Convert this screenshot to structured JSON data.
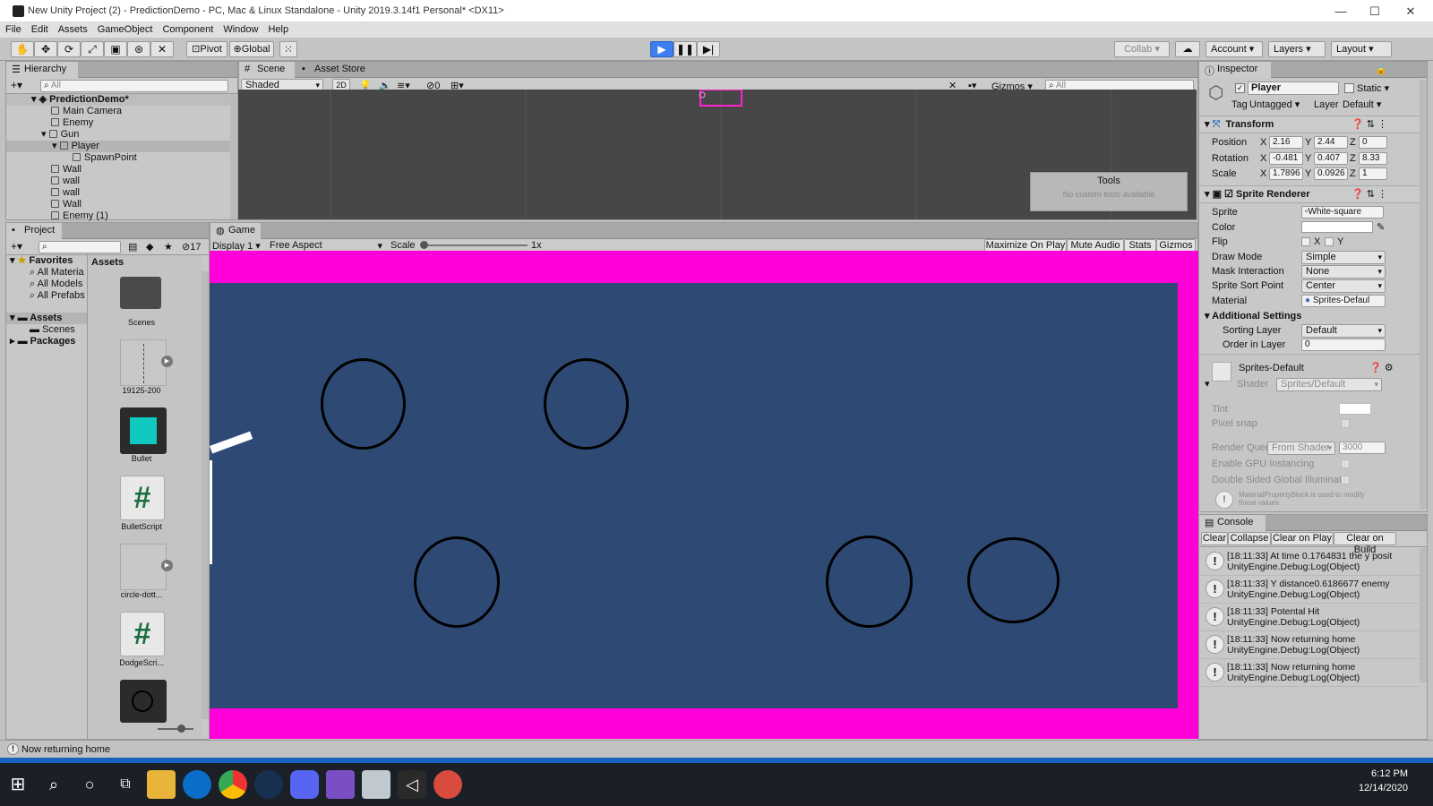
{
  "window": {
    "title": "New Unity Project (2) - PredictionDemo - PC, Mac & Linux Standalone - Unity 2019.3.14f1 Personal* <DX11>",
    "minimize": "—",
    "maximize": "☐",
    "close": "✕"
  },
  "menu": [
    "File",
    "Edit",
    "Assets",
    "GameObject",
    "Component",
    "Window",
    "Help"
  ],
  "toolbar": {
    "pivot": "Pivot",
    "global": "Global",
    "collab": "Collab",
    "account": "Account",
    "layers": "Layers",
    "layout": "Layout"
  },
  "hierarchy": {
    "tab": "Hierarchy",
    "search_placeholder": "All",
    "scene_name": "PredictionDemo*",
    "items": [
      {
        "name": "Main Camera",
        "indent": 1
      },
      {
        "name": "Enemy",
        "indent": 1
      },
      {
        "name": "Gun",
        "indent": 1
      },
      {
        "name": "Player",
        "indent": 2
      },
      {
        "name": "SpawnPoint",
        "indent": 3
      },
      {
        "name": "Wall",
        "indent": 1
      },
      {
        "name": "wall",
        "indent": 1
      },
      {
        "name": "wall",
        "indent": 1
      },
      {
        "name": "Wall",
        "indent": 1
      },
      {
        "name": "Enemy (1)",
        "indent": 1
      }
    ]
  },
  "scene": {
    "tab": "Scene",
    "asset_store_tab": "Asset Store",
    "shading": "Shaded",
    "mode2d": "2D",
    "fx_count": "0",
    "gizmos": "Gizmos",
    "search_placeholder": "All",
    "tools_title": "Tools",
    "tools_subtitle": "No custom tools available"
  },
  "project": {
    "tab": "Project",
    "count": "17",
    "favorites": "Favorites",
    "fav_items": [
      "All Materia",
      "All Models",
      "All Prefabs"
    ],
    "assets": "Assets",
    "asset_children": [
      "Scenes"
    ],
    "packages": "Packages",
    "grid_header": "Assets",
    "grid": [
      "Scenes",
      "19125-200",
      "Bullet",
      "BulletScript",
      "circle-dott...",
      "DodgeScri..."
    ]
  },
  "game": {
    "tab": "Game",
    "display": "Display 1",
    "aspect": "Free Aspect",
    "scale_label": "Scale",
    "scale_value": "1x",
    "maximize": "Maximize On Play",
    "mute": "Mute Audio",
    "stats": "Stats",
    "gizmos": "Gizmos"
  },
  "inspector": {
    "tab": "Inspector",
    "object_name": "Player",
    "static": "Static",
    "tag_label": "Tag",
    "tag": "Untagged",
    "layer_label": "Layer",
    "layer": "Default",
    "transform": {
      "title": "Transform",
      "position": {
        "label": "Position",
        "x": "2.16",
        "y": "2.44",
        "z": "0"
      },
      "rotation": {
        "label": "Rotation",
        "x": "-0.481",
        "y": "0.407",
        "z": "8.33"
      },
      "scale": {
        "label": "Scale",
        "x": "1.7896",
        "y": "0.0926",
        "z": "1"
      }
    },
    "sprite_renderer": {
      "title": "Sprite Renderer",
      "sprite_label": "Sprite",
      "sprite": "White-square",
      "color_label": "Color",
      "flip_label": "Flip",
      "flip_x": "X",
      "flip_y": "Y",
      "draw_mode_label": "Draw Mode",
      "draw_mode": "Simple",
      "mask_label": "Mask Interaction",
      "mask": "None",
      "sort_point_label": "Sprite Sort Point",
      "sort_point": "Center",
      "material_label": "Material",
      "material": "Sprites-Defaul",
      "additional": "Additional Settings",
      "sorting_layer_label": "Sorting Layer",
      "sorting_layer": "Default",
      "order_label": "Order in Layer",
      "order": "0"
    },
    "material": {
      "name": "Sprites-Default",
      "shader_label": "Shader",
      "shader": "Sprites/Default",
      "tint": "Tint",
      "pixel_snap": "Pixel snap",
      "render_queue": "Render Queu",
      "render_from": "From Shader",
      "render_value": "3000",
      "gpu": "Enable GPU Instancing",
      "double_sided": "Double Sided Global Illuminatic",
      "note": "MaterialPropertyBlock is used to modify these values"
    }
  },
  "console": {
    "tab": "Console",
    "clear": "Clear",
    "collapse": "Collapse",
    "clear_on_play": "Clear on Play",
    "clear_on_build": "Clear on Build",
    "rows": [
      {
        "line1": "[18:11:33] At time 0.1764831 the y posit",
        "line2": "UnityEngine.Debug:Log(Object)"
      },
      {
        "line1": "[18:11:33] Y distance0.6186677 enemy",
        "line2": "UnityEngine.Debug:Log(Object)"
      },
      {
        "line1": "[18:11:33] Potental Hit",
        "line2": "UnityEngine.Debug:Log(Object)"
      },
      {
        "line1": "[18:11:33] Now returning home",
        "line2": "UnityEngine.Debug:Log(Object)"
      },
      {
        "line1": "[18:11:33] Now returning home",
        "line2": "UnityEngine.Debug:Log(Object)"
      }
    ]
  },
  "status": {
    "message": "Now returning home"
  },
  "taskbar": {
    "time": "6:12 PM",
    "date": "12/14/2020"
  }
}
